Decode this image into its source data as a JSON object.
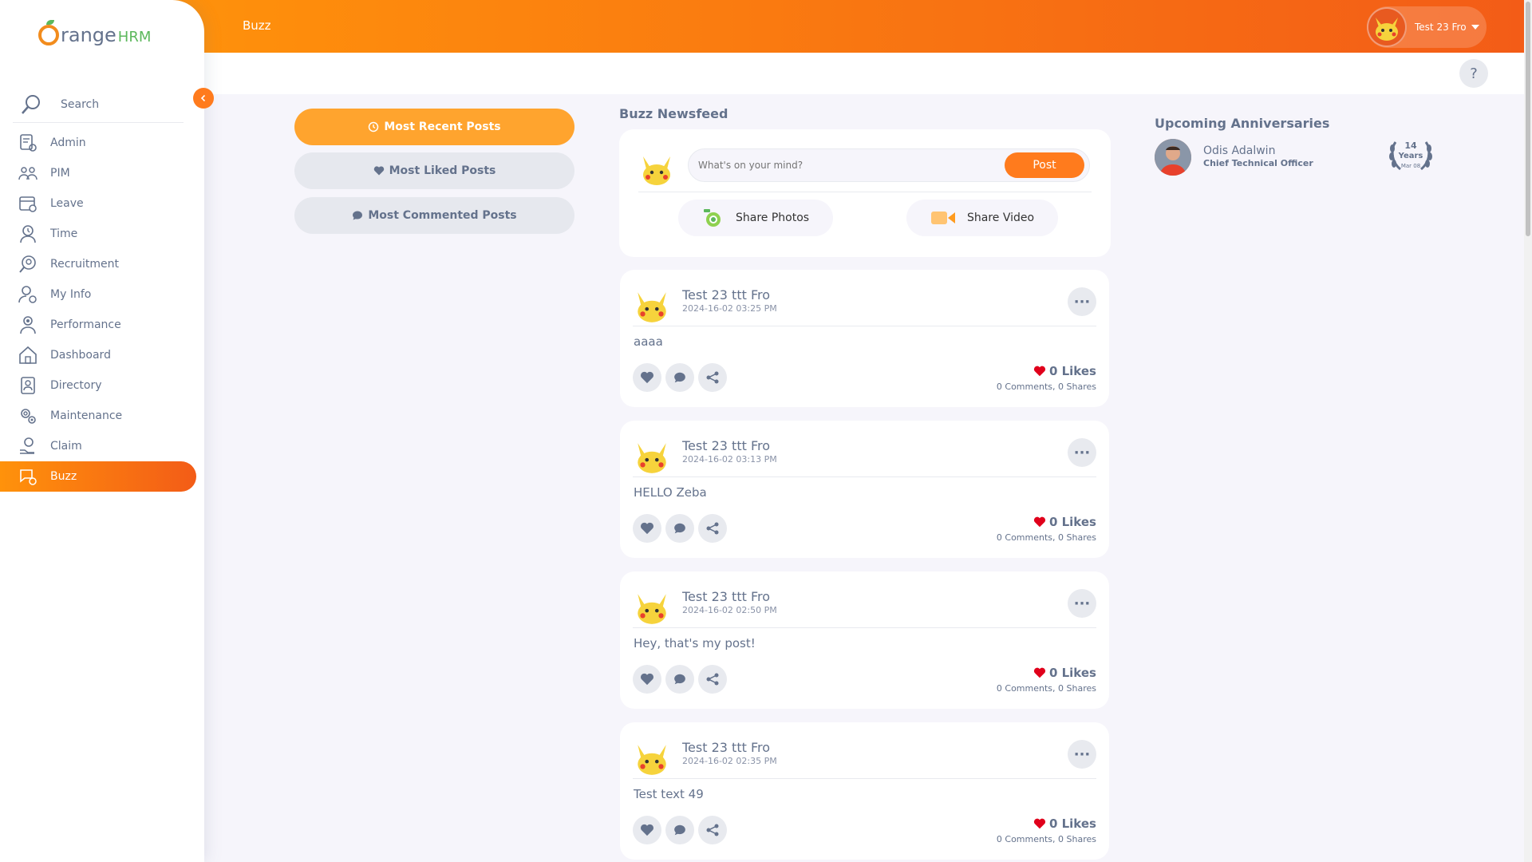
{
  "brand": {
    "logo_text": "OrangeHRM",
    "accent": "#ff7b1d",
    "gradient_start": "#ff920b",
    "gradient_end": "#f35c17"
  },
  "sidebar": {
    "search_label": "Search",
    "items": [
      {
        "label": "Admin",
        "icon": "admin-icon"
      },
      {
        "label": "PIM",
        "icon": "pim-icon"
      },
      {
        "label": "Leave",
        "icon": "leave-icon"
      },
      {
        "label": "Time",
        "icon": "time-icon"
      },
      {
        "label": "Recruitment",
        "icon": "recruitment-icon"
      },
      {
        "label": "My Info",
        "icon": "my-info-icon"
      },
      {
        "label": "Performance",
        "icon": "performance-icon"
      },
      {
        "label": "Dashboard",
        "icon": "dashboard-icon"
      },
      {
        "label": "Directory",
        "icon": "directory-icon"
      },
      {
        "label": "Maintenance",
        "icon": "maintenance-icon"
      },
      {
        "label": "Claim",
        "icon": "claim-icon"
      },
      {
        "label": "Buzz",
        "icon": "buzz-icon",
        "active": true
      }
    ]
  },
  "topbar": {
    "title": "Buzz",
    "user_name": "Test 23 Fro",
    "help": "?"
  },
  "filters": {
    "most_recent": "Most Recent Posts",
    "most_liked": "Most Liked Posts",
    "most_commented": "Most Commented Posts"
  },
  "newsfeed": {
    "title": "Buzz Newsfeed",
    "compose_placeholder": "What's on your mind?",
    "post_button": "Post",
    "share_photos": "Share Photos",
    "share_video": "Share Video"
  },
  "posts": [
    {
      "author": "Test 23 ttt Fro",
      "time": "2024-16-02 03:25 PM",
      "body": "aaaa",
      "likes": "0 Likes",
      "comments": "0 Comments",
      "shares": "0 Shares"
    },
    {
      "author": "Test 23 ttt Fro",
      "time": "2024-16-02 03:13 PM",
      "body": "HELLO Zeba",
      "likes": "0 Likes",
      "comments": "0 Comments",
      "shares": "0 Shares"
    },
    {
      "author": "Test 23 ttt Fro",
      "time": "2024-16-02 02:50 PM",
      "body": "Hey, that's my post!",
      "likes": "0 Likes",
      "comments": "0 Comments",
      "shares": "0 Shares"
    },
    {
      "author": "Test 23 ttt Fro",
      "time": "2024-16-02 02:35 PM",
      "body": "Test text 49",
      "likes": "0 Likes",
      "comments": "0 Comments",
      "shares": "0 Shares"
    }
  ],
  "anniversaries": {
    "title": "Upcoming Anniversaries",
    "items": [
      {
        "name": "Odis Adalwin",
        "role": "Chief Technical Officer",
        "years": "14",
        "years_label": "Years",
        "date": "Mar 08"
      }
    ]
  }
}
